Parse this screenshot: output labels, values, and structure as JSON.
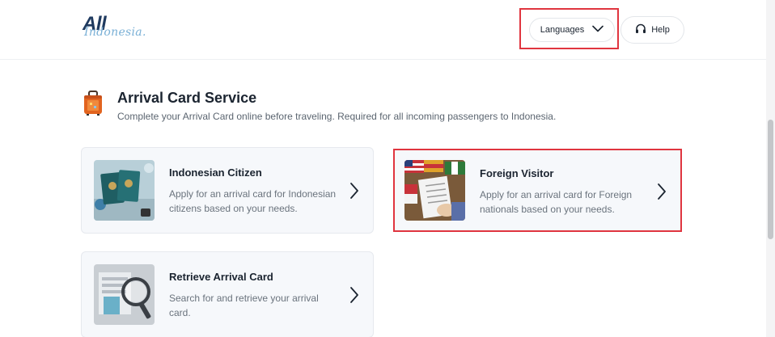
{
  "header": {
    "logo": {
      "all": "All",
      "indonesia": "Indonesia."
    },
    "languages_label": "Languages",
    "help_label": "Help"
  },
  "section": {
    "title": "Arrival Card Service",
    "subtitle": "Complete your Arrival Card online before traveling. Required for all incoming passengers to Indonesia."
  },
  "cards": [
    {
      "title": "Indonesian Citizen",
      "description": "Apply for an arrival card for Indonesian citizens based on your needs."
    },
    {
      "title": "Foreign Visitor",
      "description": "Apply for an arrival card for Foreign nationals based on your needs."
    },
    {
      "title": "Retrieve Arrival Card",
      "description": "Search for and retrieve your arrival card."
    }
  ],
  "colors": {
    "highlight": "#e0353f",
    "card_bg": "#f6f8fb",
    "brand_dark": "#1f3a5f",
    "brand_light": "#7ab0d6"
  },
  "icons": [
    "chevron-down-icon",
    "headphones-icon",
    "suitcase-icon",
    "chevron-right-icon"
  ]
}
